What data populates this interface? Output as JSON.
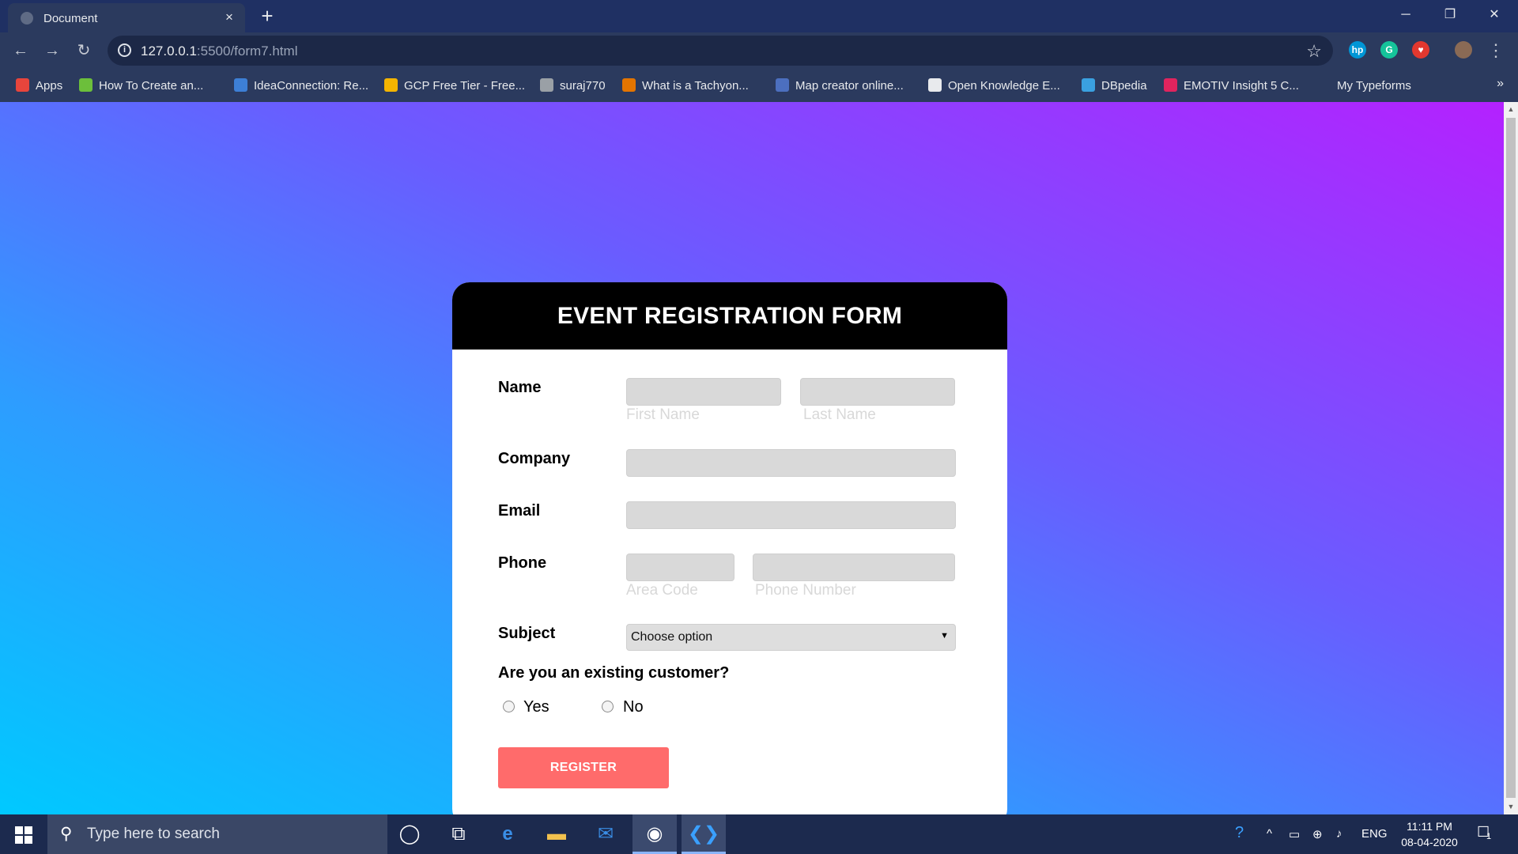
{
  "browser": {
    "tab_title": "Document",
    "tab_close": "×",
    "new_tab": "+",
    "window_controls": {
      "minimize": "─",
      "restore": "❐",
      "close": "✕"
    },
    "nav": {
      "back": "←",
      "forward": "→",
      "reload": "↻"
    },
    "url_host": "127.0.0.1",
    "url_rest": ":5500/form7.html",
    "bookmark_star": "☆",
    "menu": "⋮",
    "extensions": [
      {
        "name": "hp-extension",
        "glyph": "hp",
        "color": "#0096d6"
      },
      {
        "name": "grammarly-extension",
        "glyph": "G",
        "color": "#15c39a"
      },
      {
        "name": "shield-extension",
        "glyph": "♥",
        "color": "#e2382f"
      }
    ],
    "bookmarks": [
      {
        "label": "Apps",
        "color": "#e8453c"
      },
      {
        "label": "How To Create an...",
        "color": "#6cbf3b"
      },
      {
        "label": "IdeaConnection: Re...",
        "color": "#3d7fd6"
      },
      {
        "label": "GCP Free Tier - Free...",
        "color": "#f4b400"
      },
      {
        "label": "suraj770",
        "color": "#9aa0a6"
      },
      {
        "label": "What is a Tachyon...",
        "color": "#e37400"
      },
      {
        "label": "Map creator online...",
        "color": "#4c6fbf"
      },
      {
        "label": "Open Knowledge E...",
        "color": "#e8eaed"
      },
      {
        "label": "DBpedia",
        "color": "#3aa0e0"
      },
      {
        "label": "EMOTIV Insight 5 C...",
        "color": "#e0245e"
      },
      {
        "label": "My Typeforms",
        "color": "#2b3a5e"
      }
    ],
    "bookmarks_more": "»"
  },
  "form": {
    "title": "EVENT REGISTRATION FORM",
    "name_label": "Name",
    "first_name_hint": "First Name",
    "last_name_hint": "Last Name",
    "company_label": "Company",
    "email_label": "Email",
    "phone_label": "Phone",
    "area_code_hint": "Area Code",
    "phone_number_hint": "Phone Number",
    "subject_label": "Subject",
    "subject_selected": "Choose option",
    "customer_question": "Are you an existing customer?",
    "option_yes": "Yes",
    "option_no": "No",
    "register_label": "REGISTER"
  },
  "taskbar": {
    "search_placeholder": "Type here to search",
    "tray_lang": "ENG",
    "time": "11:11 PM",
    "date": "08-04-2020",
    "notification_count": "1"
  }
}
